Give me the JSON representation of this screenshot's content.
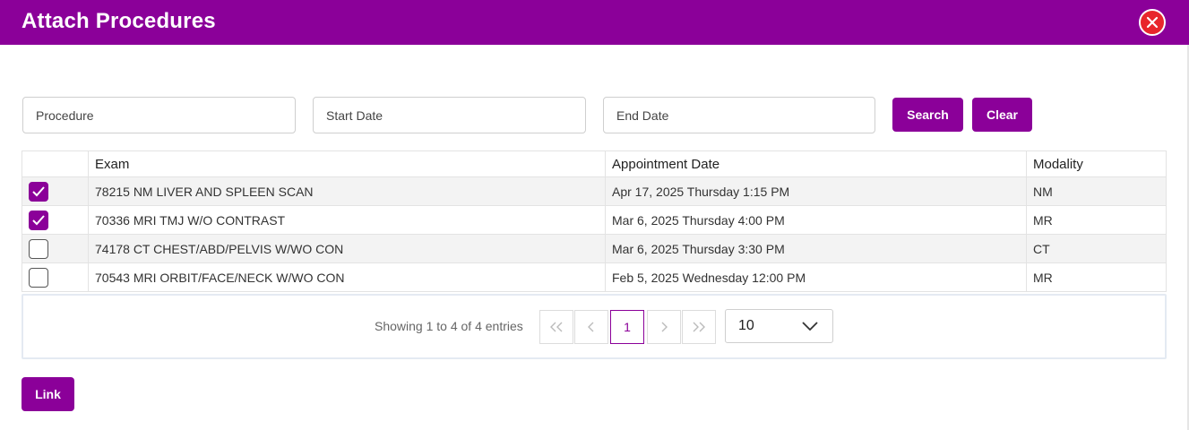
{
  "dialog": {
    "title": "Attach Procedures"
  },
  "filters": {
    "procedure_placeholder": "Procedure",
    "start_date_placeholder": "Start Date",
    "end_date_placeholder": "End Date",
    "search_label": "Search",
    "clear_label": "Clear"
  },
  "table": {
    "columns": [
      "",
      "Exam",
      "Appointment Date",
      "Modality"
    ],
    "rows": [
      {
        "checked": true,
        "exam": "78215 NM LIVER AND SPLEEN SCAN",
        "date": "Apr 17, 2025 Thursday 1:15 PM",
        "modality": "NM"
      },
      {
        "checked": true,
        "exam": "70336 MRI TMJ W/O CONTRAST",
        "date": "Mar 6, 2025 Thursday 4:00 PM",
        "modality": "MR"
      },
      {
        "checked": false,
        "exam": "74178 CT CHEST/ABD/PELVIS W/WO CON",
        "date": "Mar 6, 2025 Thursday 3:30 PM",
        "modality": "CT"
      },
      {
        "checked": false,
        "exam": "70543 MRI ORBIT/FACE/NECK W/WO CON",
        "date": "Feb 5, 2025 Wednesday 12:00 PM",
        "modality": "MR"
      }
    ]
  },
  "pagination": {
    "showing_text": "Showing 1 to 4 of 4 entries",
    "current_page": "1",
    "page_size": "10"
  },
  "actions": {
    "link_label": "Link"
  },
  "colors": {
    "brand": "#8b0099",
    "close": "#e8262c"
  },
  "icons": {
    "close": "close-icon",
    "check": "check-icon",
    "first": "double-chevron-left-icon",
    "prev": "chevron-left-icon",
    "next": "chevron-right-icon",
    "last": "double-chevron-right-icon",
    "dropdown": "chevron-down-icon"
  }
}
